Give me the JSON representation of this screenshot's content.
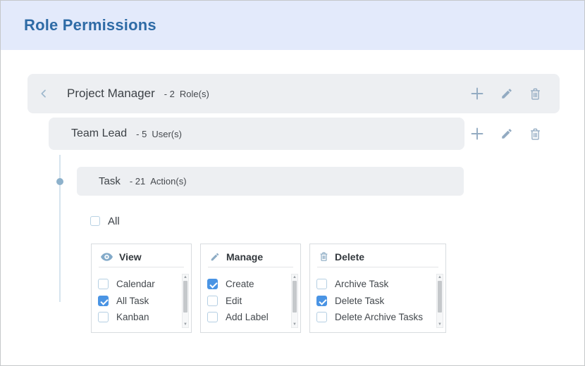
{
  "header": {
    "title": "Role Permissions"
  },
  "hierarchy": {
    "role": {
      "name": "Project Manager",
      "count": "- 2",
      "unit": "Role(s)"
    },
    "user": {
      "name": "Team Lead",
      "count": "- 5",
      "unit": "User(s)"
    },
    "entity": {
      "name": "Task",
      "count": "- 21",
      "unit": "Action(s)"
    }
  },
  "select_all": {
    "label": "All",
    "checked": false
  },
  "cards": [
    {
      "id": "view",
      "title": "View",
      "icon": "eye-icon",
      "items": [
        {
          "label": "Calendar",
          "checked": false
        },
        {
          "label": "All Task",
          "checked": true
        },
        {
          "label": "Kanban",
          "checked": false
        }
      ]
    },
    {
      "id": "manage",
      "title": "Manage",
      "icon": "pencil-icon",
      "items": [
        {
          "label": "Create",
          "checked": true
        },
        {
          "label": "Edit",
          "checked": false
        },
        {
          "label": "Add Label",
          "checked": false
        }
      ]
    },
    {
      "id": "delete",
      "title": "Delete",
      "icon": "trash-icon",
      "items": [
        {
          "label": "Archive Task",
          "checked": false
        },
        {
          "label": "Delete Task",
          "checked": true
        },
        {
          "label": "Delete Archive Tasks",
          "checked": false
        }
      ]
    }
  ],
  "icons": {
    "row_actions": [
      "plus-icon",
      "pencil-icon",
      "trash-icon"
    ],
    "back": "chevron-left-icon"
  },
  "scrollbar": {
    "up_glyph": "▲",
    "down_glyph": "▼"
  },
  "colors": {
    "header_bg": "#e3eafb",
    "header_title": "#2e6ba6",
    "row_bg": "#edeff2",
    "muted_icon": "#93abc2",
    "checkbox_checked": "#4a94e4",
    "checkbox_border": "#b5cfe3",
    "connector": "#8db1cb"
  }
}
